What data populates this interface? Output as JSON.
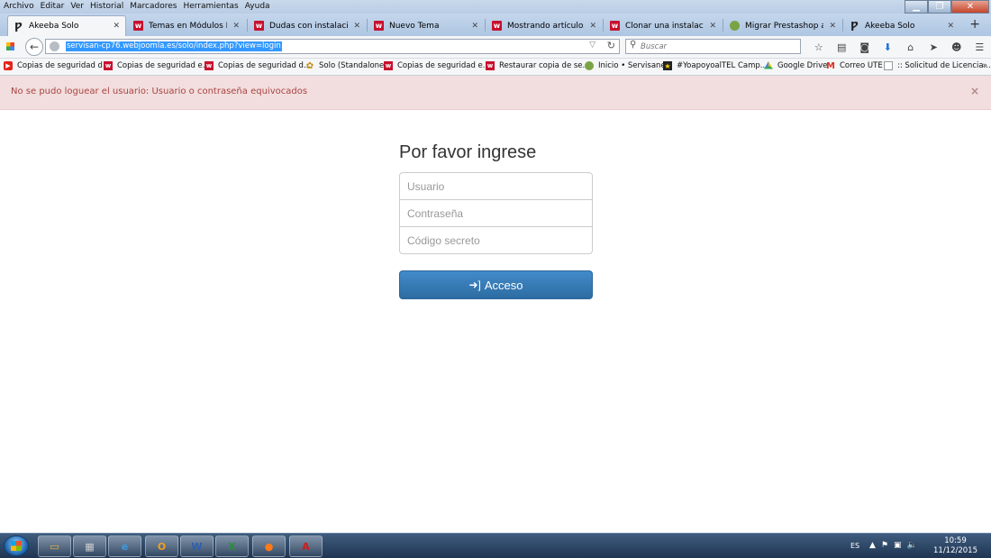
{
  "menubar": {
    "items": [
      "Archivo",
      "Editar",
      "Ver",
      "Historial",
      "Marcadores",
      "Herramientas",
      "Ayuda"
    ]
  },
  "tabs": [
    {
      "label": "Akeeba Solo",
      "icon": "akeeba-icon",
      "active": true
    },
    {
      "label": "Temas en Módulos Pr...",
      "icon": "webempresa-icon",
      "active": false
    },
    {
      "label": "Dudas con instalación...",
      "icon": "webempresa-icon",
      "active": false
    },
    {
      "label": "Nuevo Tema",
      "icon": "webempresa-icon",
      "active": false
    },
    {
      "label": "Mostrando artículos p...",
      "icon": "webempresa-icon",
      "active": false
    },
    {
      "label": "Clonar una instalación...",
      "icon": "webempresa-icon",
      "active": false
    },
    {
      "label": "Migrar Prestashop a o...",
      "icon": "servisanex-icon",
      "active": false
    },
    {
      "label": "Akeeba Solo",
      "icon": "akeeba-icon",
      "active": false
    }
  ],
  "navbar": {
    "url": "servisan-cp76.webjoomla.es/solo/index.php?view=login",
    "search_placeholder": "Buscar"
  },
  "bookmarks": [
    {
      "label": "Copias de seguridad d...",
      "icon": "youtube-icon"
    },
    {
      "label": "Copias de seguridad e...",
      "icon": "webempresa-icon"
    },
    {
      "label": "Copias de seguridad d...",
      "icon": "webempresa-icon"
    },
    {
      "label": "Solo (Standalone)",
      "icon": "joomla-icon"
    },
    {
      "label": "Copias de seguridad e...",
      "icon": "webempresa-icon"
    },
    {
      "label": "Restaurar copia de se...",
      "icon": "webempresa-icon"
    },
    {
      "label": "Inicio • Servisanex",
      "icon": "servisanex-icon"
    },
    {
      "label": "#YoapoyoalTEL Camp...",
      "icon": "star-icon"
    },
    {
      "label": "Google Drive",
      "icon": "drive-icon"
    },
    {
      "label": "Correo UTE",
      "icon": "gmail-icon"
    },
    {
      "label": ":: Solicitud de Licencia...",
      "icon": "page-icon"
    }
  ],
  "alert": {
    "message": "No se pudo loguear el usuario: Usuario o contraseña equivocados",
    "color_bg": "#f2dede",
    "color_text": "#a94442"
  },
  "login": {
    "title": "Por favor ingrese",
    "username_placeholder": "Usuario",
    "password_placeholder": "Contraseña",
    "secret_placeholder": "Código secreto",
    "submit_label": "Acceso",
    "button_color": "#428bca"
  },
  "taskbar": {
    "language": "ES",
    "time": "10:59",
    "date": "11/12/2015",
    "apps": [
      "explorer",
      "calculator",
      "internet-explorer",
      "outlook",
      "word",
      "excel",
      "firefox",
      "acrobat"
    ]
  }
}
